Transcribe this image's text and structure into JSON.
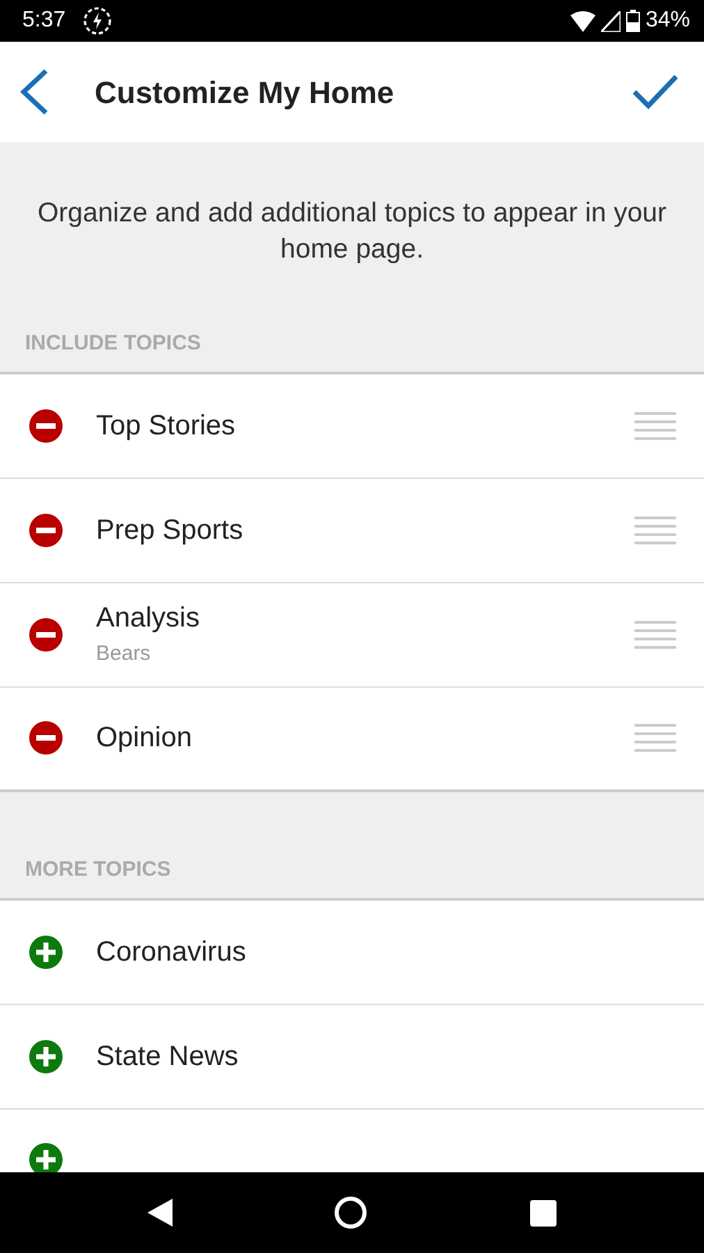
{
  "status_bar": {
    "time": "5:37",
    "battery": "34%"
  },
  "header": {
    "title": "Customize My Home"
  },
  "intro": "Organize and add additional topics to appear in your home page.",
  "sections": [
    {
      "heading": "INCLUDE TOPICS",
      "items": [
        {
          "kind": "remove",
          "title": "Top Stories"
        },
        {
          "kind": "remove",
          "title": "Prep Sports"
        },
        {
          "kind": "remove",
          "title": "Analysis",
          "subtitle": "Bears"
        },
        {
          "kind": "remove",
          "title": "Opinion"
        }
      ]
    },
    {
      "heading": "MORE TOPICS",
      "items": [
        {
          "kind": "add",
          "title": "Coronavirus"
        },
        {
          "kind": "add",
          "title": "State News"
        },
        {
          "kind": "add"
        }
      ]
    }
  ]
}
